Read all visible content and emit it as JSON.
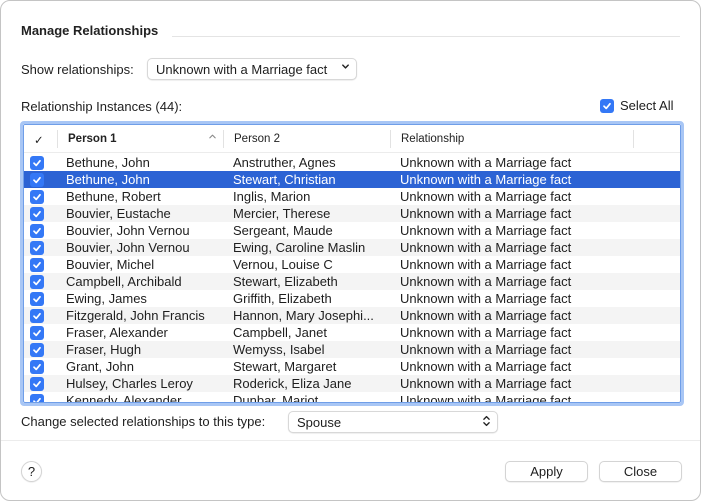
{
  "dialog": {
    "title": "Manage Relationships"
  },
  "filter": {
    "label": "Show relationships:",
    "selected": "Unknown with a Marriage fact"
  },
  "instances": {
    "label": "Relationship Instances (44):",
    "select_all_label": "Select All",
    "select_all_checked": true
  },
  "table": {
    "columns": [
      {
        "label": "✓"
      },
      {
        "label": "Person 1",
        "sorted": "ascending"
      },
      {
        "label": "Person 2"
      },
      {
        "label": "Relationship"
      }
    ],
    "rows": [
      {
        "checked": true,
        "person1": "Bethune, John",
        "person2": "Anstruther, Agnes",
        "relationship": "Unknown with a Marriage fact",
        "selected": false
      },
      {
        "checked": true,
        "person1": "Bethune, John",
        "person2": "Stewart, Christian",
        "relationship": "Unknown with a Marriage fact",
        "selected": true
      },
      {
        "checked": true,
        "person1": "Bethune, Robert",
        "person2": "Inglis, Marion",
        "relationship": "Unknown with a Marriage fact",
        "selected": false
      },
      {
        "checked": true,
        "person1": "Bouvier, Eustache",
        "person2": "Mercier, Therese",
        "relationship": "Unknown with a Marriage fact",
        "selected": false
      },
      {
        "checked": true,
        "person1": "Bouvier, John Vernou",
        "person2": "Sergeant, Maude",
        "relationship": "Unknown with a Marriage fact",
        "selected": false
      },
      {
        "checked": true,
        "person1": "Bouvier, John Vernou",
        "person2": "Ewing, Caroline Maslin",
        "relationship": "Unknown with a Marriage fact",
        "selected": false
      },
      {
        "checked": true,
        "person1": "Bouvier, Michel",
        "person2": "Vernou, Louise C",
        "relationship": "Unknown with a Marriage fact",
        "selected": false
      },
      {
        "checked": true,
        "person1": "Campbell, Archibald",
        "person2": "Stewart, Elizabeth",
        "relationship": "Unknown with a Marriage fact",
        "selected": false
      },
      {
        "checked": true,
        "person1": "Ewing, James",
        "person2": "Griffith, Elizabeth",
        "relationship": "Unknown with a Marriage fact",
        "selected": false
      },
      {
        "checked": true,
        "person1": "Fitzgerald, John Francis",
        "person2": "Hannon, Mary Josephi...",
        "relationship": "Unknown with a Marriage fact",
        "selected": false
      },
      {
        "checked": true,
        "person1": "Fraser, Alexander",
        "person2": "Campbell, Janet",
        "relationship": "Unknown with a Marriage fact",
        "selected": false
      },
      {
        "checked": true,
        "person1": "Fraser, Hugh",
        "person2": "Wemyss, Isabel",
        "relationship": "Unknown with a Marriage fact",
        "selected": false
      },
      {
        "checked": true,
        "person1": "Grant, John",
        "person2": "Stewart, Margaret",
        "relationship": "Unknown with a Marriage fact",
        "selected": false
      },
      {
        "checked": true,
        "person1": "Hulsey, Charles Leroy",
        "person2": "Roderick, Eliza Jane",
        "relationship": "Unknown with a Marriage fact",
        "selected": false
      },
      {
        "checked": true,
        "person1": "Kennedy, Alexander",
        "person2": "Dunbar, Mariot",
        "relationship": "Unknown with a Marriage fact",
        "selected": false
      }
    ]
  },
  "change_type": {
    "label": "Change selected relationships to this type:",
    "selected": "Spouse"
  },
  "footer": {
    "help_label": "?",
    "apply_label": "Apply",
    "close_label": "Close"
  },
  "colors": {
    "accent": "#3478f6",
    "selection": "#2c63d4",
    "focus_ring": "#a8c6f5"
  }
}
